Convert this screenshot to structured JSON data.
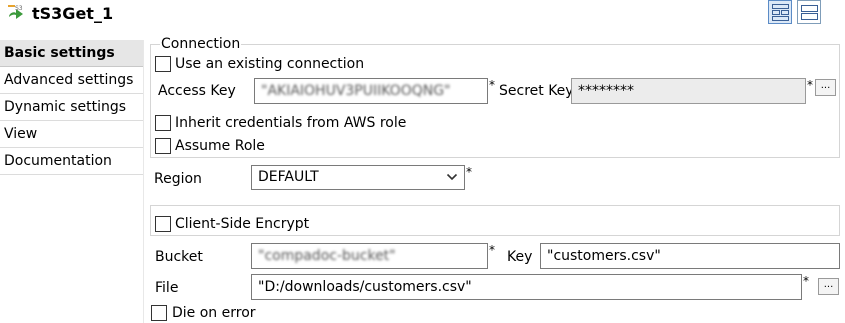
{
  "title": "tS3Get_1",
  "icons": {
    "component": "s3-bucket-icon",
    "view_grid": "grid-view-icon",
    "view_list": "list-view-icon"
  },
  "sidebar": {
    "items": [
      {
        "label": "Basic settings",
        "active": true
      },
      {
        "label": "Advanced settings",
        "active": false
      },
      {
        "label": "Dynamic settings",
        "active": false
      },
      {
        "label": "View",
        "active": false
      },
      {
        "label": "Documentation",
        "active": false
      }
    ]
  },
  "connection": {
    "legend": "Connection",
    "use_existing_label": "Use an existing connection",
    "use_existing_checked": false,
    "access_key_label": "Access Key",
    "access_key_value": "\"AKIAIOHUV3PUIIKOOQNG\"",
    "secret_key_label": "Secret Key",
    "secret_key_value": "********",
    "required_marker": "*",
    "more_button": "...",
    "inherit_label": "Inherit credentials from AWS role",
    "inherit_checked": false,
    "assume_role_label": "Assume Role",
    "assume_role_checked": false
  },
  "region": {
    "label": "Region",
    "value": "DEFAULT",
    "required_marker": "*"
  },
  "encrypt": {
    "label": "Client-Side Encrypt",
    "checked": false
  },
  "bucket": {
    "label": "Bucket",
    "value": "\"compadoc-bucket\"",
    "required_marker": "*"
  },
  "key": {
    "label": "Key",
    "value": "\"customers.csv\""
  },
  "file": {
    "label": "File",
    "value": "\"D:/downloads/customers.csv\"",
    "required_marker": "*",
    "more_button": "..."
  },
  "die_on_error": {
    "label": "Die on error",
    "checked": false
  }
}
